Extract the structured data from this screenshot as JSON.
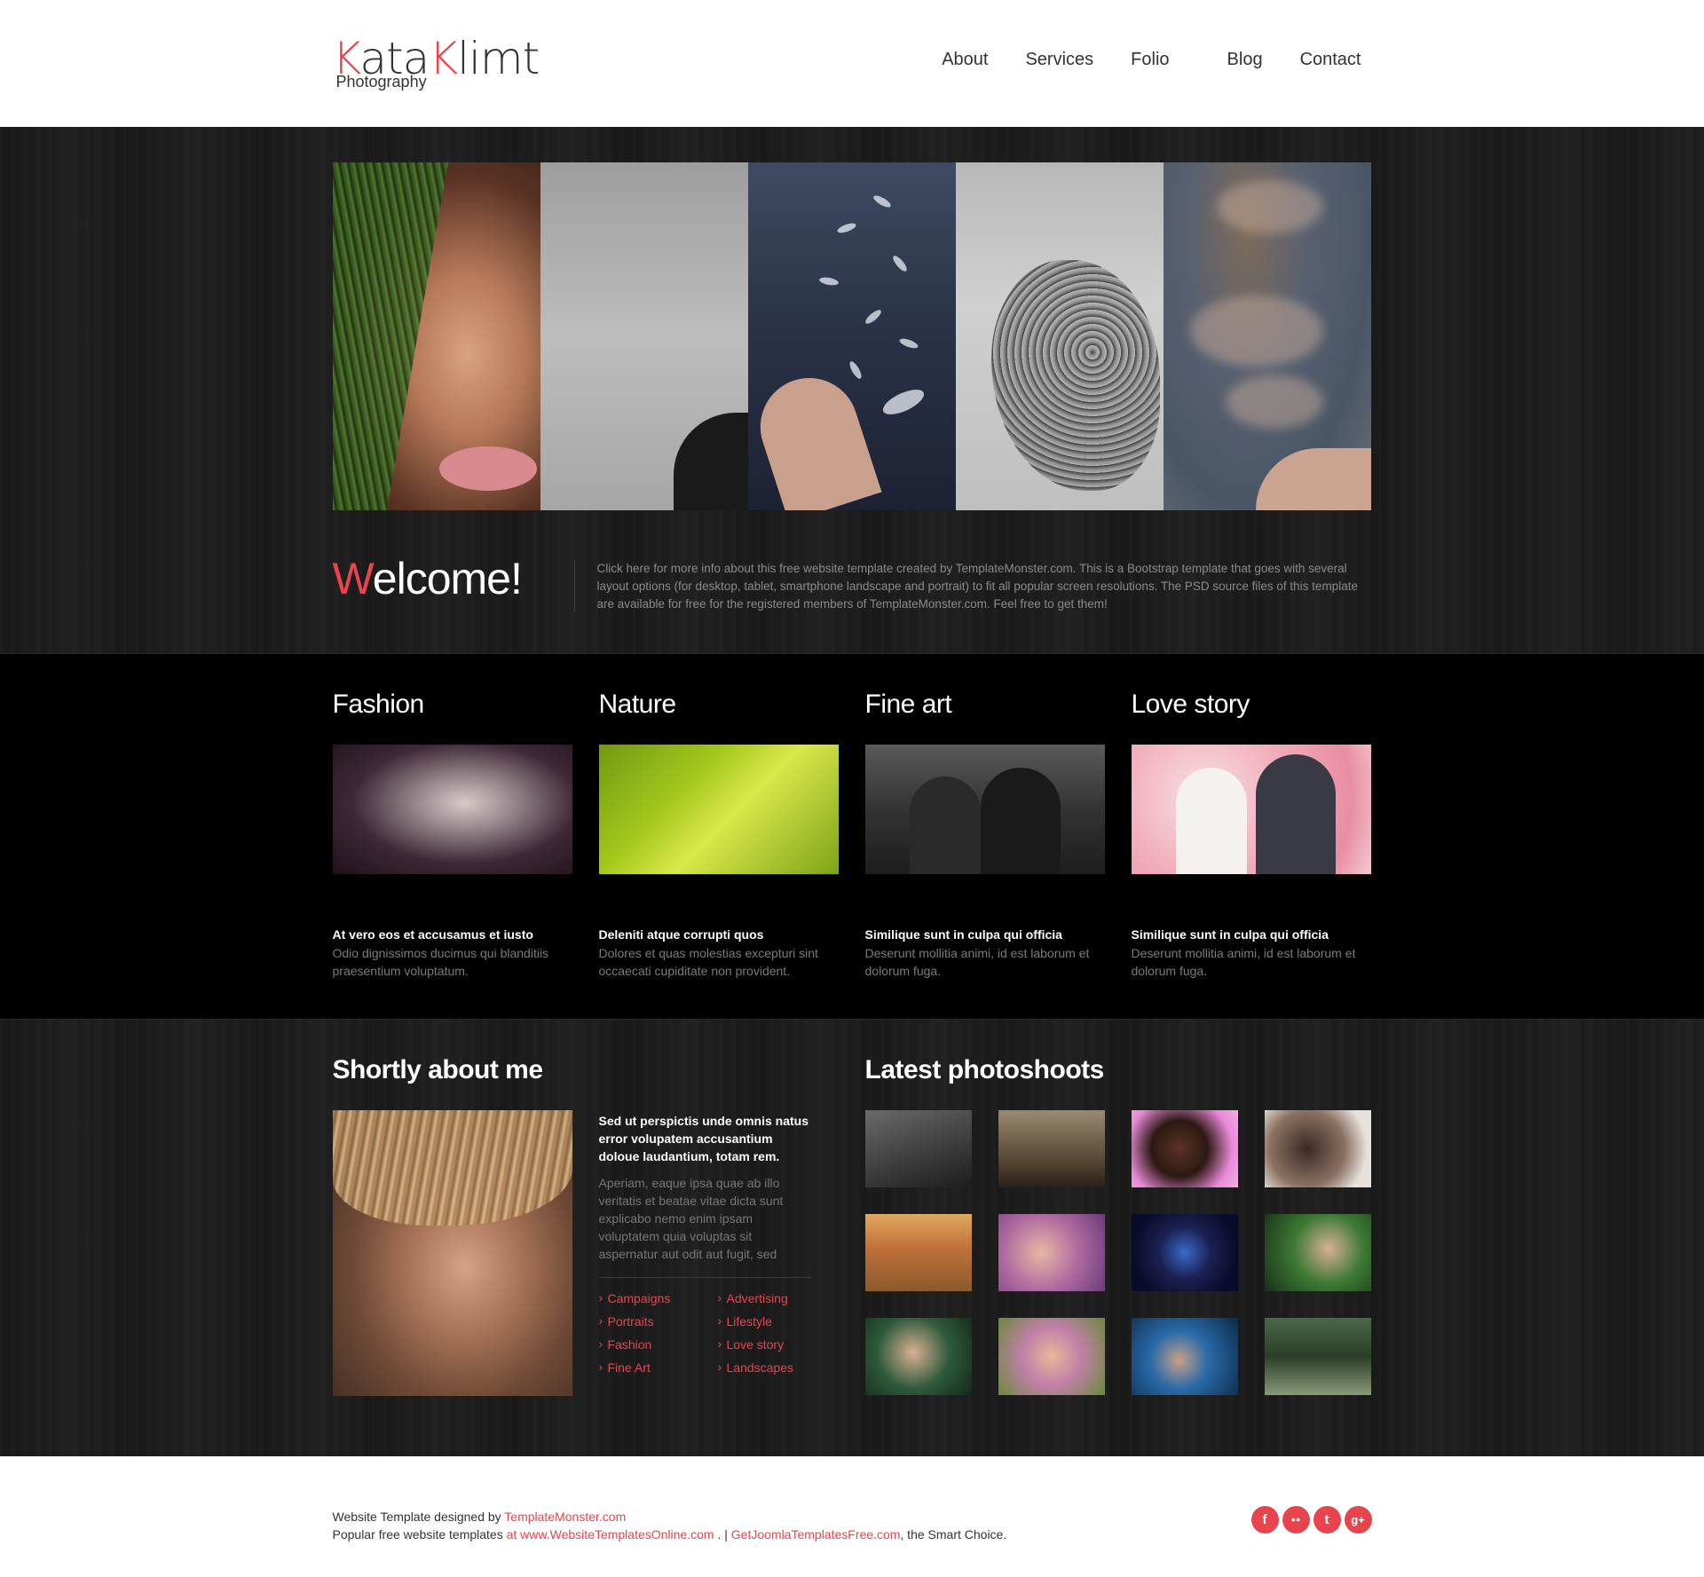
{
  "header": {
    "logo_kata_k": "K",
    "logo_kata_rest": "ata",
    "logo_klimt_k": "K",
    "logo_klimt_rest": "limt",
    "logo_sub": "Photography",
    "nav": [
      "About",
      "Services",
      "Folio",
      "Blog",
      "Contact"
    ]
  },
  "welcome": {
    "title_first": "W",
    "title_rest": "elcome!",
    "text": "Click here for more info about this free website template created by TemplateMonster.com. This is a Bootstrap template that goes with several layout options (for desktop, tablet, smartphone landscape and portrait) to fit all popular screen resolutions. The PSD source files of this template are available for free for the registered members of TemplateMonster.com. Feel free to get them!"
  },
  "categories": [
    {
      "title": "Fashion",
      "subtitle": "At vero eos et accusamus et iusto",
      "desc": "Odio dignissimos ducimus qui blanditiis praesentium voluptatum."
    },
    {
      "title": "Nature",
      "subtitle": "Deleniti atque corrupti quos",
      "desc": "Dolores et quas molestias excepturi sint occaecati cupiditate non provident."
    },
    {
      "title": "Fine art",
      "subtitle": "Similique sunt in culpa qui officia",
      "desc": "Deserunt mollitia animi, id est laborum et dolorum fuga."
    },
    {
      "title": "Love story",
      "subtitle": "Similique sunt in culpa qui officia",
      "desc": "Deserunt mollitia animi, id est laborum et dolorum fuga."
    }
  ],
  "about": {
    "title": "Shortly about me",
    "lead": "Sed ut perspictis unde omnis natus error volupatem accusantium doloue laudantium, totam rem.",
    "body": "Aperiam, eaque ipsa quae ab illo veritatis et beatae vitae dicta sunt explicabo nemo enim ipsam voluptatem quia voluptas sit aspernatur aut odit aut fugit, sed",
    "links": [
      "Campaigns",
      "Advertising",
      "Portraits",
      "Lifestyle",
      "Fashion",
      "Love story",
      "Fine Art",
      "Landscapes"
    ]
  },
  "latest": {
    "title": "Latest photoshoots"
  },
  "footer": {
    "line1_prefix": "Website Template designed by ",
    "line1_link": "TemplateMonster.com",
    "line2_prefix": "Popular free website templates ",
    "line2_link1": "at www.WebsiteTemplatesOnline.com",
    "line2_sep": " . | ",
    "line2_link2": "GetJoomlaTemplatesFree.com",
    "line2_suffix": ", the Smart Choice.",
    "social": [
      "f",
      "●●",
      "t",
      "g+"
    ]
  },
  "colors": {
    "accent": "#e8444d",
    "header_bg": "#ffffff",
    "dark_bg": "#1c1c1c",
    "black_bg": "#000000"
  },
  "icons": [
    "facebook-icon",
    "flickr-icon",
    "twitter-icon",
    "google-plus-icon"
  ]
}
